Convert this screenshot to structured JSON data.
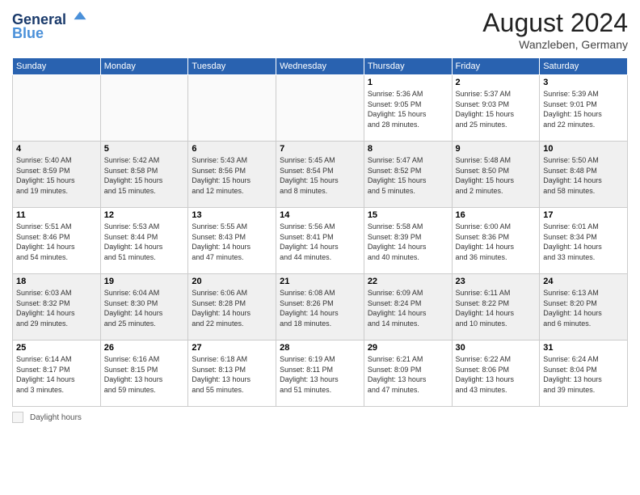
{
  "header": {
    "logo_line1": "General",
    "logo_line2": "Blue",
    "month_year": "August 2024",
    "location": "Wanzleben, Germany"
  },
  "days_of_week": [
    "Sunday",
    "Monday",
    "Tuesday",
    "Wednesday",
    "Thursday",
    "Friday",
    "Saturday"
  ],
  "weeks": [
    [
      {
        "day": "",
        "info": ""
      },
      {
        "day": "",
        "info": ""
      },
      {
        "day": "",
        "info": ""
      },
      {
        "day": "",
        "info": ""
      },
      {
        "day": "1",
        "info": "Sunrise: 5:36 AM\nSunset: 9:05 PM\nDaylight: 15 hours\nand 28 minutes."
      },
      {
        "day": "2",
        "info": "Sunrise: 5:37 AM\nSunset: 9:03 PM\nDaylight: 15 hours\nand 25 minutes."
      },
      {
        "day": "3",
        "info": "Sunrise: 5:39 AM\nSunset: 9:01 PM\nDaylight: 15 hours\nand 22 minutes."
      }
    ],
    [
      {
        "day": "4",
        "info": "Sunrise: 5:40 AM\nSunset: 8:59 PM\nDaylight: 15 hours\nand 19 minutes."
      },
      {
        "day": "5",
        "info": "Sunrise: 5:42 AM\nSunset: 8:58 PM\nDaylight: 15 hours\nand 15 minutes."
      },
      {
        "day": "6",
        "info": "Sunrise: 5:43 AM\nSunset: 8:56 PM\nDaylight: 15 hours\nand 12 minutes."
      },
      {
        "day": "7",
        "info": "Sunrise: 5:45 AM\nSunset: 8:54 PM\nDaylight: 15 hours\nand 8 minutes."
      },
      {
        "day": "8",
        "info": "Sunrise: 5:47 AM\nSunset: 8:52 PM\nDaylight: 15 hours\nand 5 minutes."
      },
      {
        "day": "9",
        "info": "Sunrise: 5:48 AM\nSunset: 8:50 PM\nDaylight: 15 hours\nand 2 minutes."
      },
      {
        "day": "10",
        "info": "Sunrise: 5:50 AM\nSunset: 8:48 PM\nDaylight: 14 hours\nand 58 minutes."
      }
    ],
    [
      {
        "day": "11",
        "info": "Sunrise: 5:51 AM\nSunset: 8:46 PM\nDaylight: 14 hours\nand 54 minutes."
      },
      {
        "day": "12",
        "info": "Sunrise: 5:53 AM\nSunset: 8:44 PM\nDaylight: 14 hours\nand 51 minutes."
      },
      {
        "day": "13",
        "info": "Sunrise: 5:55 AM\nSunset: 8:43 PM\nDaylight: 14 hours\nand 47 minutes."
      },
      {
        "day": "14",
        "info": "Sunrise: 5:56 AM\nSunset: 8:41 PM\nDaylight: 14 hours\nand 44 minutes."
      },
      {
        "day": "15",
        "info": "Sunrise: 5:58 AM\nSunset: 8:39 PM\nDaylight: 14 hours\nand 40 minutes."
      },
      {
        "day": "16",
        "info": "Sunrise: 6:00 AM\nSunset: 8:36 PM\nDaylight: 14 hours\nand 36 minutes."
      },
      {
        "day": "17",
        "info": "Sunrise: 6:01 AM\nSunset: 8:34 PM\nDaylight: 14 hours\nand 33 minutes."
      }
    ],
    [
      {
        "day": "18",
        "info": "Sunrise: 6:03 AM\nSunset: 8:32 PM\nDaylight: 14 hours\nand 29 minutes."
      },
      {
        "day": "19",
        "info": "Sunrise: 6:04 AM\nSunset: 8:30 PM\nDaylight: 14 hours\nand 25 minutes."
      },
      {
        "day": "20",
        "info": "Sunrise: 6:06 AM\nSunset: 8:28 PM\nDaylight: 14 hours\nand 22 minutes."
      },
      {
        "day": "21",
        "info": "Sunrise: 6:08 AM\nSunset: 8:26 PM\nDaylight: 14 hours\nand 18 minutes."
      },
      {
        "day": "22",
        "info": "Sunrise: 6:09 AM\nSunset: 8:24 PM\nDaylight: 14 hours\nand 14 minutes."
      },
      {
        "day": "23",
        "info": "Sunrise: 6:11 AM\nSunset: 8:22 PM\nDaylight: 14 hours\nand 10 minutes."
      },
      {
        "day": "24",
        "info": "Sunrise: 6:13 AM\nSunset: 8:20 PM\nDaylight: 14 hours\nand 6 minutes."
      }
    ],
    [
      {
        "day": "25",
        "info": "Sunrise: 6:14 AM\nSunset: 8:17 PM\nDaylight: 14 hours\nand 3 minutes."
      },
      {
        "day": "26",
        "info": "Sunrise: 6:16 AM\nSunset: 8:15 PM\nDaylight: 13 hours\nand 59 minutes."
      },
      {
        "day": "27",
        "info": "Sunrise: 6:18 AM\nSunset: 8:13 PM\nDaylight: 13 hours\nand 55 minutes."
      },
      {
        "day": "28",
        "info": "Sunrise: 6:19 AM\nSunset: 8:11 PM\nDaylight: 13 hours\nand 51 minutes."
      },
      {
        "day": "29",
        "info": "Sunrise: 6:21 AM\nSunset: 8:09 PM\nDaylight: 13 hours\nand 47 minutes."
      },
      {
        "day": "30",
        "info": "Sunrise: 6:22 AM\nSunset: 8:06 PM\nDaylight: 13 hours\nand 43 minutes."
      },
      {
        "day": "31",
        "info": "Sunrise: 6:24 AM\nSunset: 8:04 PM\nDaylight: 13 hours\nand 39 minutes."
      }
    ]
  ],
  "footer": {
    "daylight_label": "Daylight hours"
  }
}
